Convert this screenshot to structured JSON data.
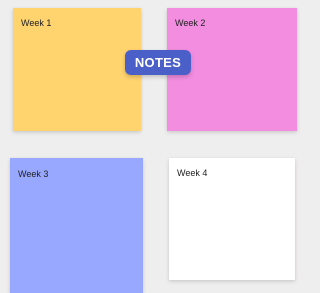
{
  "badge": {
    "label": "NOTES",
    "color": "#4b5fc9"
  },
  "notes": [
    {
      "title": "Week 1",
      "color": "#ffd36e"
    },
    {
      "title": "Week 2",
      "color": "#f28de0"
    },
    {
      "title": "Week 3",
      "color": "#99a8ff"
    },
    {
      "title": "Week 4",
      "color": "#ffffff"
    }
  ],
  "background": "#efeeee"
}
